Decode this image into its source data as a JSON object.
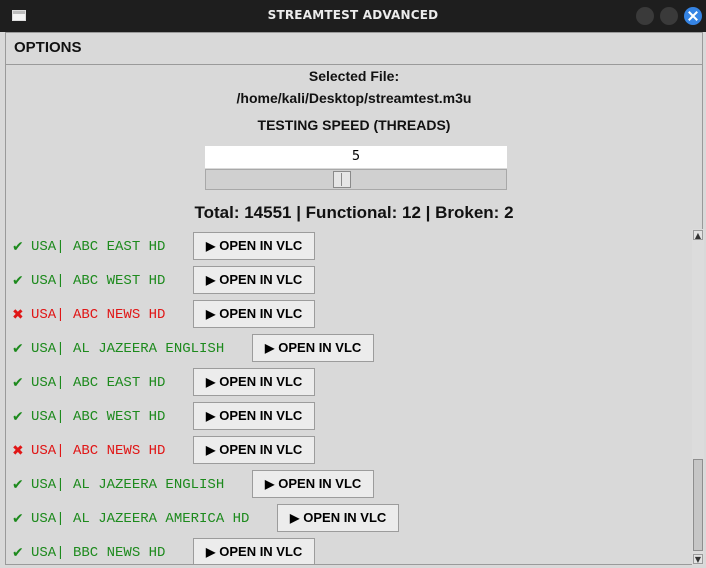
{
  "window": {
    "title": "STREAMTEST ADVANCED"
  },
  "options": {
    "header": "OPTIONS",
    "selected_file_label": "Selected File:",
    "selected_file_path": "/home/kali/Desktop/streamtest.m3u",
    "speed_label": "TESTING SPEED (THREADS)",
    "speed_value": "5",
    "slider_fraction": 0.45
  },
  "summary": "Total: 14551 | Functional: 12 | Broken: 2",
  "streams": [
    {
      "status": "ok",
      "icon": "✔",
      "name": "USA| ABC EAST HD",
      "button": "OPEN IN VLC"
    },
    {
      "status": "ok",
      "icon": "✔",
      "name": "USA| ABC WEST HD",
      "button": "OPEN IN VLC"
    },
    {
      "status": "bad",
      "icon": "✖",
      "name": "USA| ABC NEWS HD",
      "button": "OPEN IN VLC"
    },
    {
      "status": "ok",
      "icon": "✔",
      "name": "USA| AL JAZEERA ENGLISH",
      "button": "OPEN IN VLC"
    },
    {
      "status": "ok",
      "icon": "✔",
      "name": "USA| ABC EAST HD",
      "button": "OPEN IN VLC"
    },
    {
      "status": "ok",
      "icon": "✔",
      "name": "USA| ABC WEST HD",
      "button": "OPEN IN VLC"
    },
    {
      "status": "bad",
      "icon": "✖",
      "name": "USA| ABC NEWS HD",
      "button": "OPEN IN VLC"
    },
    {
      "status": "ok",
      "icon": "✔",
      "name": "USA| AL JAZEERA ENGLISH",
      "button": "OPEN IN VLC"
    },
    {
      "status": "ok",
      "icon": "✔",
      "name": "USA| AL JAZEERA AMERICA HD",
      "button": "OPEN IN VLC"
    },
    {
      "status": "ok",
      "icon": "✔",
      "name": "USA| BBC NEWS HD",
      "button": "OPEN IN VLC"
    }
  ],
  "icons": {
    "play": "▶",
    "scroll_up": "▲",
    "scroll_down": "▼"
  },
  "colors": {
    "ok": "#1d8a1d",
    "bad": "#e01616",
    "close_button": "#3584e4"
  }
}
